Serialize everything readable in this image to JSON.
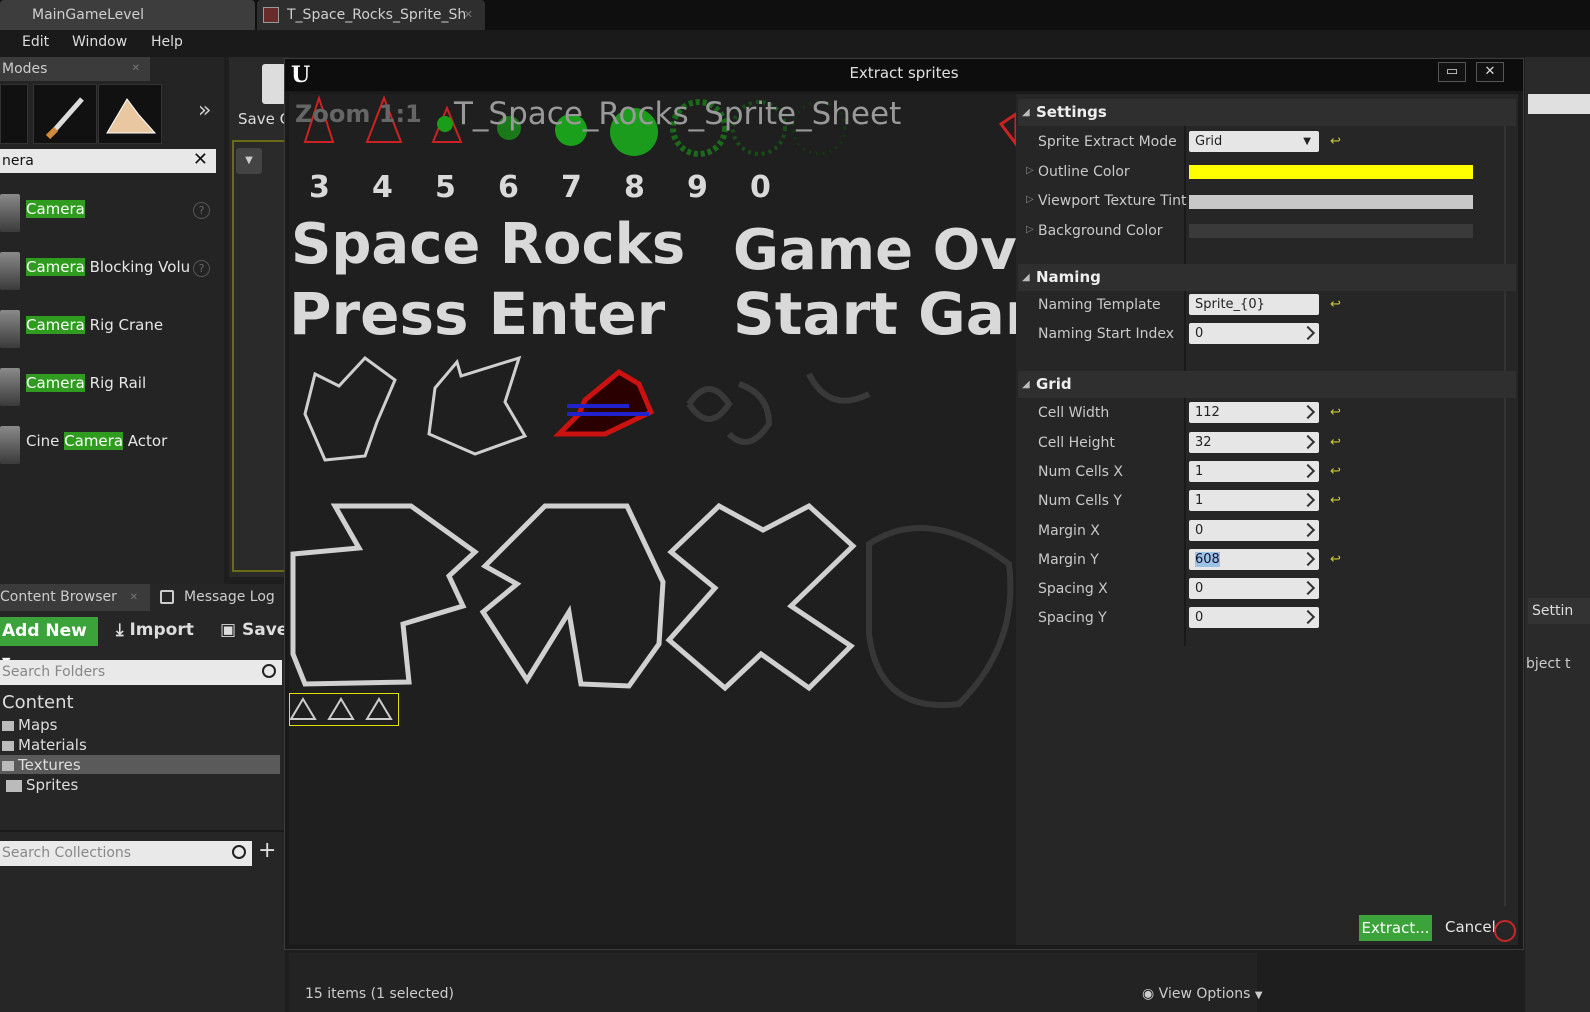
{
  "tabs": [
    {
      "label": "MainGameLevel"
    },
    {
      "label": "T_Space_Rocks_Sprite_Sh"
    }
  ],
  "menu": [
    "Edit",
    "Window",
    "Help"
  ],
  "modes": {
    "title": "Modes",
    "search_value": "nera",
    "items": [
      {
        "pre": "",
        "hl": "Camera",
        "post": ""
      },
      {
        "pre": "",
        "hl": "Camera",
        "post": " Blocking Volu"
      },
      {
        "pre": "",
        "hl": "Camera",
        "post": " Rig Crane"
      },
      {
        "pre": "",
        "hl": "Camera",
        "post": " Rig Rail"
      },
      {
        "pre": "Cine ",
        "hl": "Camera",
        "post": " Actor"
      }
    ]
  },
  "viewport": {
    "save_label": "Save C"
  },
  "content_browser": {
    "tab": "Content Browser",
    "log_tab": "Message Log",
    "add_new": "Add New",
    "import": "Import",
    "save": "Save",
    "search_folders": "Search Folders",
    "search_collections": "Search Collections",
    "tree": [
      "Content",
      "Maps",
      "Materials",
      "Textures",
      "Sprites"
    ],
    "items_count": "15 items (1 selected)",
    "view_options": "View Options"
  },
  "dialog": {
    "title": "Extract sprites",
    "extract": "Extract...",
    "cancel": "Cancel",
    "canvas": {
      "zoom": "Zoom 1:1",
      "texture": "T_Space_Rocks_Sprite_Sheet",
      "digits": [
        "3",
        "4",
        "5",
        "6",
        "7",
        "8",
        "9",
        "0"
      ],
      "line1": "Space Rocks",
      "line2": "Press Enter",
      "line3": "Game Ov",
      "line4": "Start Gar"
    },
    "settings": {
      "header": "Settings",
      "mode_label": "Sprite Extract Mode",
      "mode_value": "Grid",
      "outline_label": "Outline Color",
      "outline_color": "#ffff00",
      "tint_label": "Viewport Texture Tint",
      "tint_color": "#c8c8c8",
      "bg_label": "Background Color",
      "bg_color": "#3a3a3a"
    },
    "naming": {
      "header": "Naming",
      "template_label": "Naming Template",
      "template_value": "Sprite_{0}",
      "start_label": "Naming Start Index",
      "start_value": "0"
    },
    "grid": {
      "header": "Grid",
      "rows": [
        {
          "label": "Cell Width",
          "value": "112"
        },
        {
          "label": "Cell Height",
          "value": "32"
        },
        {
          "label": "Num Cells X",
          "value": "1"
        },
        {
          "label": "Num Cells Y",
          "value": "1"
        },
        {
          "label": "Margin X",
          "value": "0"
        },
        {
          "label": "Margin Y",
          "value": "608"
        },
        {
          "label": "Spacing X",
          "value": "0"
        },
        {
          "label": "Spacing Y",
          "value": "0"
        }
      ]
    }
  },
  "right": {
    "settings": "Settin",
    "object_text": "bject t"
  }
}
